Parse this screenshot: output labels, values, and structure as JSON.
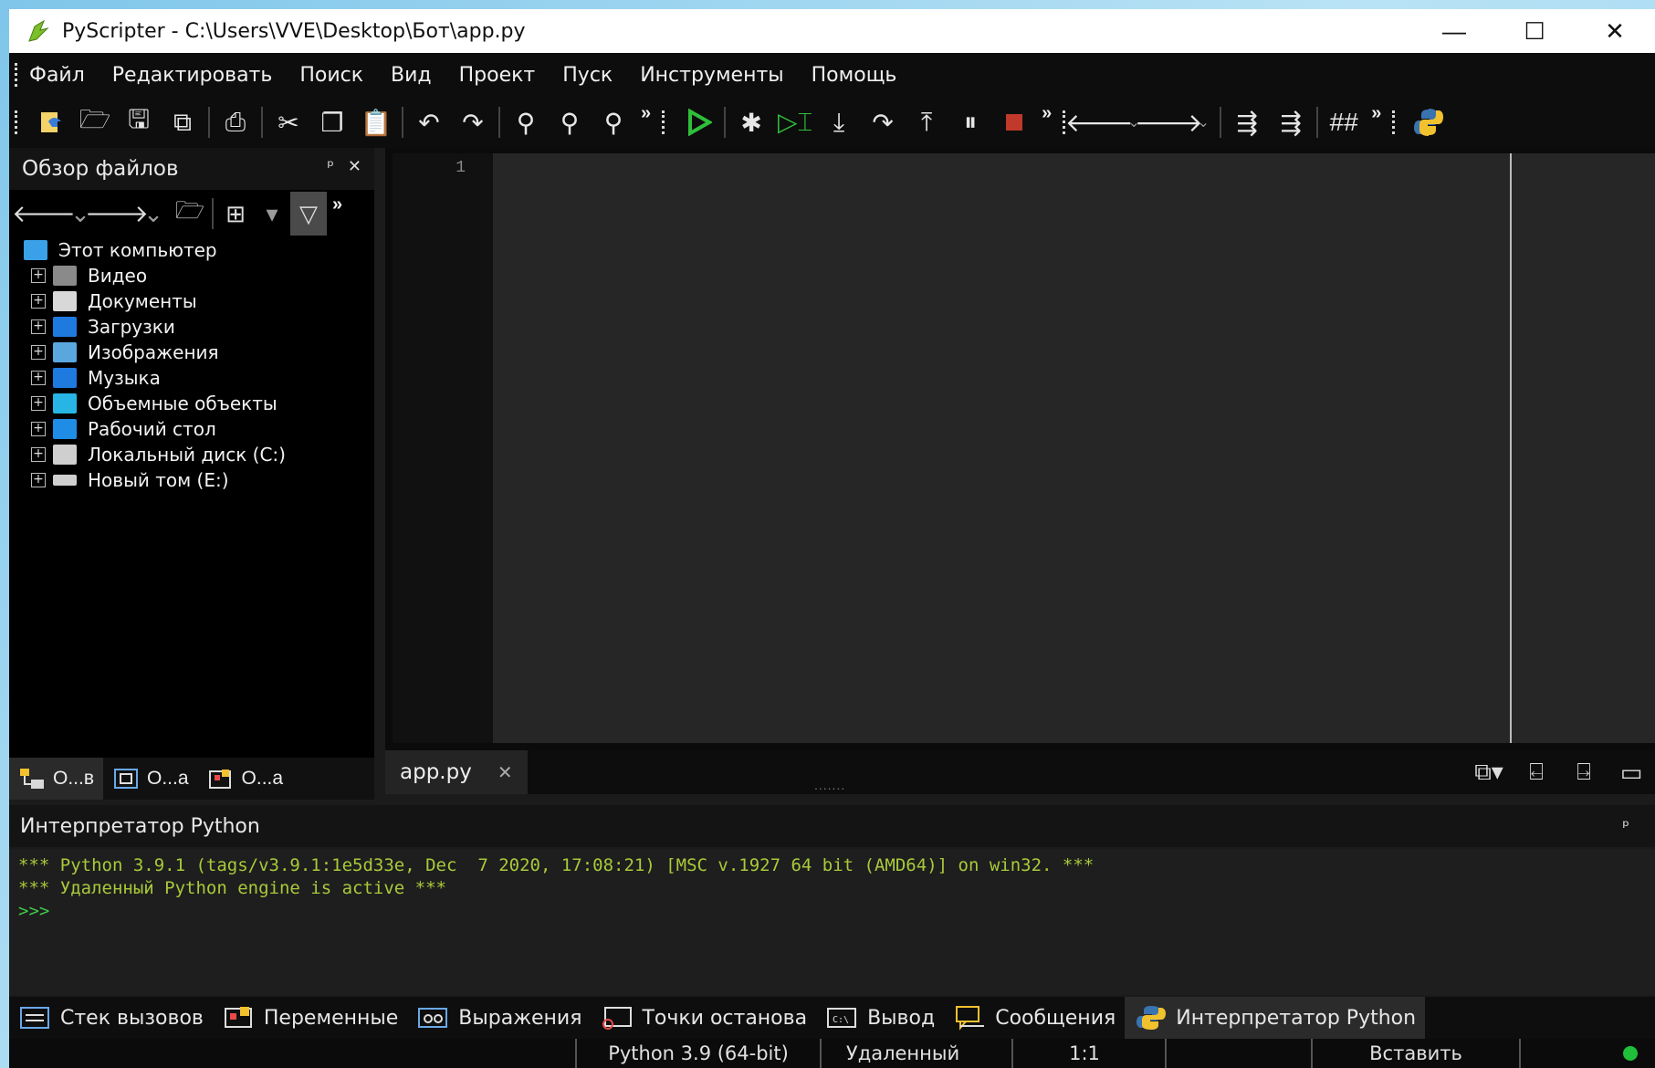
{
  "window": {
    "title": "PyScripter - C:\\Users\\VVE\\Desktop\\Бот\\app.py",
    "controls": {
      "minimize": "—",
      "maximize": "☐",
      "close": "✕"
    }
  },
  "menu": [
    "Файл",
    "Редактировать",
    "Поиск",
    "Вид",
    "Проект",
    "Пуск",
    "Инструменты",
    "Помощь"
  ],
  "toolbar": {
    "icons": [
      "new-file-icon",
      "open-icon",
      "save-icon",
      "save-all-icon",
      "print-icon",
      "cut-icon",
      "copy-icon",
      "paste-icon",
      "undo-icon",
      "redo-icon",
      "find-icon",
      "find-next-icon",
      "replace-icon",
      "run-icon",
      "debug-icon",
      "run-to-cursor-icon",
      "step-into-icon",
      "step-over-icon",
      "step-out-icon",
      "pause-icon",
      "stop-icon",
      "back-icon",
      "forward-icon",
      "indent-icon",
      "dedent-icon",
      "comment-icon",
      "python-icon"
    ],
    "run_color": "#2fbf3a",
    "stop_color": "#c0392b"
  },
  "file_browser": {
    "title": "Обзор файлов",
    "pin": "ᵖ",
    "close": "✕",
    "root": "Этот компьютер",
    "items": [
      {
        "label": "Видео",
        "icon": "video-folder-icon",
        "color": "#8a8a8a"
      },
      {
        "label": "Документы",
        "icon": "documents-folder-icon",
        "color": "#d8d8d8"
      },
      {
        "label": "Загрузки",
        "icon": "downloads-folder-icon",
        "color": "#1f7ae0"
      },
      {
        "label": "Изображения",
        "icon": "pictures-folder-icon",
        "color": "#5aa7e0"
      },
      {
        "label": "Музыка",
        "icon": "music-folder-icon",
        "color": "#1f7ae0"
      },
      {
        "label": "Объемные объекты",
        "icon": "3d-objects-folder-icon",
        "color": "#27b5e6"
      },
      {
        "label": "Рабочий стол",
        "icon": "desktop-folder-icon",
        "color": "#1f8de6"
      },
      {
        "label": "Локальный диск (C:)",
        "icon": "local-disk-icon",
        "color": "#cfcfcf"
      },
      {
        "label": "Новый том (E:)",
        "icon": "drive-icon",
        "color": "#cfcfcf"
      }
    ],
    "tabs": [
      "О...в",
      "О...а",
      "О...а"
    ]
  },
  "editor": {
    "line_numbers": [
      "1"
    ],
    "tab_label": "app.py",
    "tab_close": "✕",
    "splitter": "......."
  },
  "interpreter": {
    "title": "Интерпретатор Python",
    "pin": "ᵖ",
    "lines": [
      "*** Python 3.9.1 (tags/v3.9.1:1e5d33e, Dec  7 2020, 17:08:21) [MSC v.1927 64 bit (AMD64)] on win32. ***",
      "*** Удаленный Python engine is active ***"
    ],
    "prompt": ">>>"
  },
  "bottom_tabs": [
    {
      "label": "Стек вызовов",
      "icon": "call-stack-icon"
    },
    {
      "label": "Переменные",
      "icon": "variables-icon"
    },
    {
      "label": "Выражения",
      "icon": "watches-icon"
    },
    {
      "label": "Точки останова",
      "icon": "breakpoints-icon"
    },
    {
      "label": "Вывод",
      "icon": "output-icon"
    },
    {
      "label": "Сообщения",
      "icon": "messages-icon"
    },
    {
      "label": "Интерпретатор Python",
      "icon": "python-interpreter-icon",
      "active": true
    }
  ],
  "status": {
    "python_version": "Python 3.9 (64-bit)",
    "engine": "Удаленный",
    "position": "1:1",
    "mode": "Вставить",
    "indicator_color": "#1fbf3a"
  }
}
